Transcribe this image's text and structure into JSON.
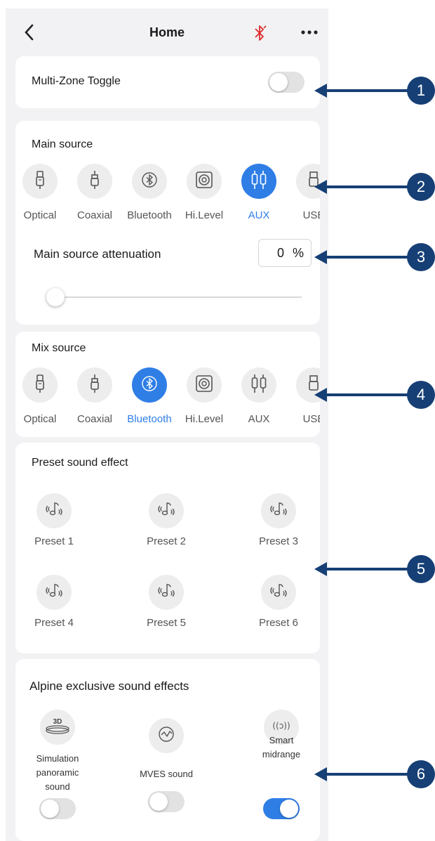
{
  "header": {
    "title": "Home",
    "back_icon": "chevron-left-icon",
    "status_icon": "bluetooth-off-icon",
    "status_color": "#e02b2b",
    "more_icon": "more-dots-icon"
  },
  "multizone": {
    "label": "Multi-Zone Toggle",
    "on": false
  },
  "main_source": {
    "title": "Main source",
    "items": [
      {
        "label": "Optical",
        "icon": "optical-icon",
        "active": false
      },
      {
        "label": "Coaxial",
        "icon": "coaxial-icon",
        "active": false
      },
      {
        "label": "Bluetooth",
        "icon": "bluetooth-icon",
        "active": false
      },
      {
        "label": "Hi.Level",
        "icon": "speaker-icon",
        "active": false
      },
      {
        "label": "AUX",
        "icon": "aux-icon",
        "active": true
      },
      {
        "label": "USB",
        "icon": "usb-icon",
        "active": false
      }
    ],
    "attenuation_label": "Main source attenuation",
    "attenuation_value": "0",
    "attenuation_unit": "%",
    "attenuation_level": 0
  },
  "mix_source": {
    "title": "Mix source",
    "items": [
      {
        "label": "Optical",
        "icon": "optical-icon",
        "active": false
      },
      {
        "label": "Coaxial",
        "icon": "coaxial-icon",
        "active": false
      },
      {
        "label": "Bluetooth",
        "icon": "bluetooth-icon",
        "active": true
      },
      {
        "label": "Hi.Level",
        "icon": "speaker-icon",
        "active": false
      },
      {
        "label": "AUX",
        "icon": "aux-icon",
        "active": false
      },
      {
        "label": "USB",
        "icon": "usb-icon",
        "active": false
      }
    ]
  },
  "presets": {
    "title": "Preset sound effect",
    "items": [
      "Preset 1",
      "Preset 2",
      "Preset 3",
      "Preset 4",
      "Preset 5",
      "Preset 6"
    ]
  },
  "alpine": {
    "title": "Alpine exclusive sound effects",
    "items": [
      {
        "icon_text": "3D",
        "label_lines": [
          "Simulation",
          "panoramic",
          "sound"
        ],
        "on": false
      },
      {
        "icon_text": "",
        "label_lines": [
          "MVES sound"
        ],
        "on": false
      },
      {
        "icon_text": "((ɔ))",
        "label_lines": [
          "Smart",
          "midrange"
        ],
        "on": true
      }
    ]
  },
  "callouts": [
    "1",
    "2",
    "3",
    "4",
    "5",
    "6"
  ],
  "colors": {
    "accent": "#2f7ee6",
    "callout": "#163f75",
    "background": "#f2f2f4"
  }
}
